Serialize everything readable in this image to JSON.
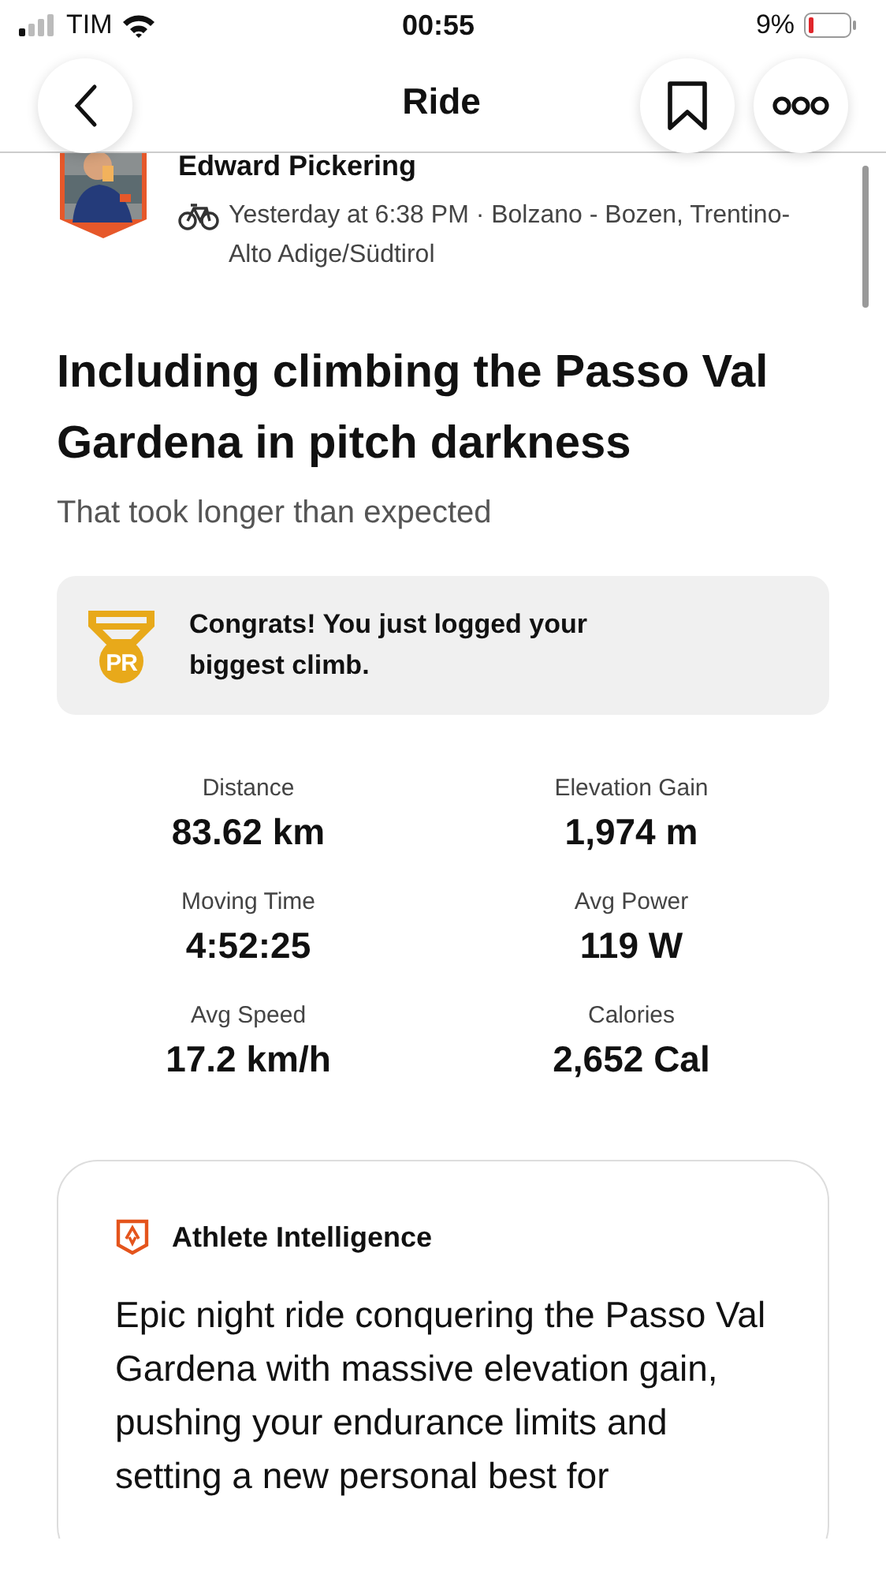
{
  "status_bar": {
    "carrier": "TIM",
    "time": "00:55",
    "battery": "9%"
  },
  "nav": {
    "title": "Ride"
  },
  "athlete": {
    "name": "Edward Pickering",
    "meta": "Yesterday at 6:38 PM · Bolzano - Bozen, Trentino-Alto Adige/Südtirol"
  },
  "activity": {
    "title": "Including climbing the Passo Val Gardena in pitch darkness",
    "description": "That took longer than expected"
  },
  "achievement": {
    "badge": "PR",
    "text": "Congrats! You just logged your biggest climb."
  },
  "stats": [
    {
      "label": "Distance",
      "value": "83.62 km"
    },
    {
      "label": "Elevation Gain",
      "value": "1,974 m"
    },
    {
      "label": "Moving Time",
      "value": "4:52:25"
    },
    {
      "label": "Avg Power",
      "value": "119 W"
    },
    {
      "label": "Avg Speed",
      "value": "17.2 km/h"
    },
    {
      "label": "Calories",
      "value": "2,652 Cal"
    }
  ],
  "insight": {
    "title": "Athlete Intelligence",
    "text": "Epic night ride conquering the Passo Val Gardena with massive elevation gain, pushing your endurance limits and setting a new personal best for"
  }
}
